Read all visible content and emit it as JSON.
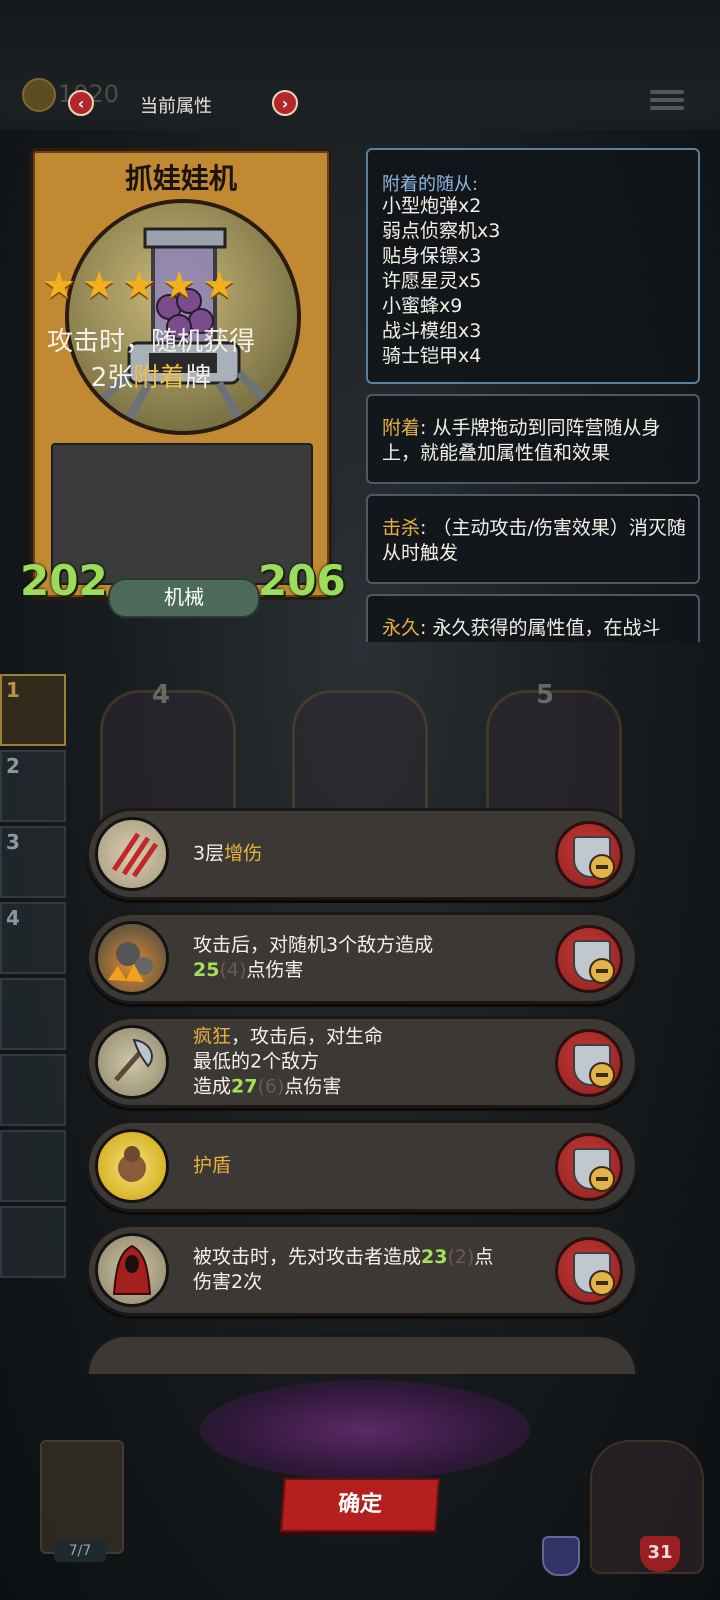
{
  "header": {
    "gold": "1020",
    "title": "当前属性",
    "prev_icon": "chevron-left-icon",
    "next_icon": "chevron-right-icon",
    "menu_icon": "menu-icon"
  },
  "card": {
    "name": "抓娃娃机",
    "stars": 5,
    "desc_prefix": "攻击时，随机获得",
    "desc_count": "2张",
    "desc_keyword": "附着",
    "desc_suffix": "牌",
    "attack": "202",
    "health": "206",
    "type": "机械"
  },
  "followers": {
    "heading": "附着的随从:",
    "items": [
      "小型炮弹x2",
      "弱点侦察机x3",
      "贴身保镖x3",
      "许愿星灵x5",
      "小蜜蜂x9",
      "战斗模组x3",
      "骑士铠甲x4"
    ]
  },
  "keywords": [
    {
      "name": "附着",
      "text": ": 从手牌拖动到同阵营随从身上，就能叠加属性值和效果"
    },
    {
      "name": "击杀",
      "text": ": （主动攻击/伤害效果）消灭随从时触发"
    },
    {
      "name": "永久",
      "text": ": 永久获得的属性值，在战斗"
    }
  ],
  "background": {
    "ranks": [
      "1",
      "2",
      "3",
      "4"
    ],
    "card_costs": [
      "4",
      "5"
    ],
    "deck_count": "7/7",
    "hero_health": "31"
  },
  "effects": [
    {
      "icon": "claw-scratch-icon",
      "part1": "3层",
      "keyword": "增伤"
    },
    {
      "icon": "bomb-icon",
      "line1": "攻击后，对随机3个敌方造成",
      "value": "25",
      "dim": "(4)",
      "line2_suffix": "点伤害"
    },
    {
      "icon": "axe-icon",
      "keyword": "疯狂",
      "line1_suffix": "，攻击后，对生命",
      "line2": "最低的2个敌方",
      "prefix3": "造成",
      "value": "27",
      "dim": "(6)",
      "suffix3": "点伤害"
    },
    {
      "icon": "shield-bear-icon",
      "keyword": "护盾"
    },
    {
      "icon": "red-cloak-icon",
      "line1": "被攻击时，先对攻击者造成",
      "value": "23",
      "dim": "(2)",
      "suffix1": "点",
      "line2": "伤害2次"
    }
  ],
  "confirm_label": "确定",
  "colors": {
    "accent_gold": "#e8b13b",
    "value_green": "#a6e05b",
    "button_red": "#b3201f"
  }
}
